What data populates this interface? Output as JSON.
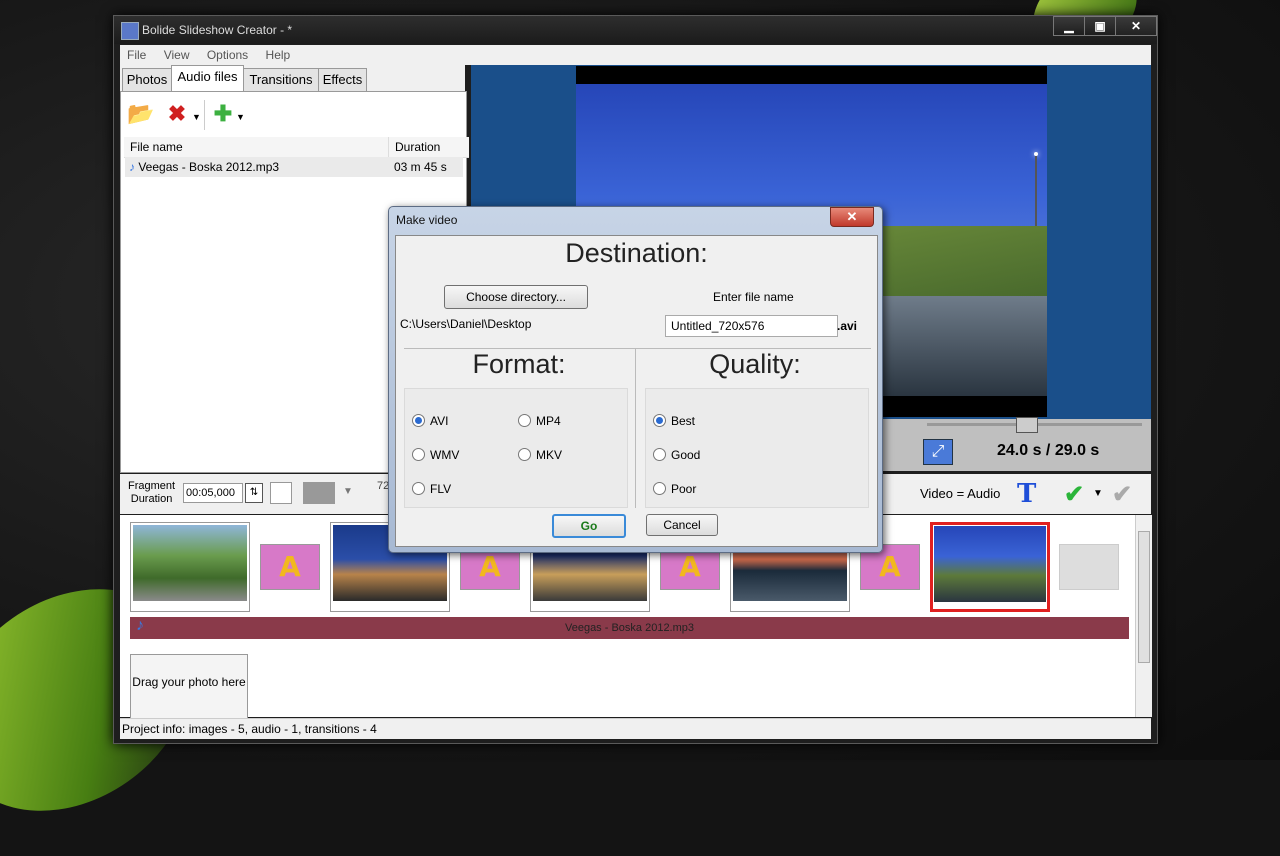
{
  "window": {
    "title": "Bolide Slideshow Creator - *",
    "min": "▁",
    "max": "▣",
    "close": "✕"
  },
  "menu": [
    "File",
    "View",
    "Options",
    "Help"
  ],
  "tabs": [
    "Photos",
    "Audio files",
    "Transitions",
    "Effects"
  ],
  "filelist": {
    "col_name": "File name",
    "col_duration": "Duration",
    "rows": [
      {
        "name": "Veegas - Boska 2012.mp3",
        "duration": "03 m 45 s"
      }
    ]
  },
  "preview": {
    "time": "24.0 s  / 29.0 s"
  },
  "fragment": {
    "label": "Fragment\nDuration",
    "value": "00:05,000",
    "partial_text": "72"
  },
  "toolbar_right": {
    "video_audio": "Video = Audio",
    "t_label": "T"
  },
  "timeline": {
    "audio_track": "Veegas - Boska 2012.mp3",
    "transition_glyph": "A",
    "drag_hint": "Drag your photo here"
  },
  "status": "Project info: images - 5, audio - 1, transitions - 4",
  "dialog": {
    "title": "Make video",
    "destination_header": "Destination:",
    "choose_dir": "Choose directory...",
    "enter_name_label": "Enter file name",
    "dir_path": "C:\\Users\\Daniel\\Desktop",
    "filename": "Untitled_720x576",
    "ext": ".avi",
    "format_header": "Format:",
    "quality_header": "Quality:",
    "formats": [
      "AVI",
      "MP4",
      "WMV",
      "MKV",
      "FLV"
    ],
    "selected_format": "AVI",
    "qualities": [
      "Best",
      "Good",
      "Poor"
    ],
    "selected_quality": "Best",
    "go": "Go",
    "cancel": "Cancel"
  },
  "icons": {
    "open": "folder-open-icon",
    "delete": "delete-icon",
    "add": "add-icon"
  }
}
